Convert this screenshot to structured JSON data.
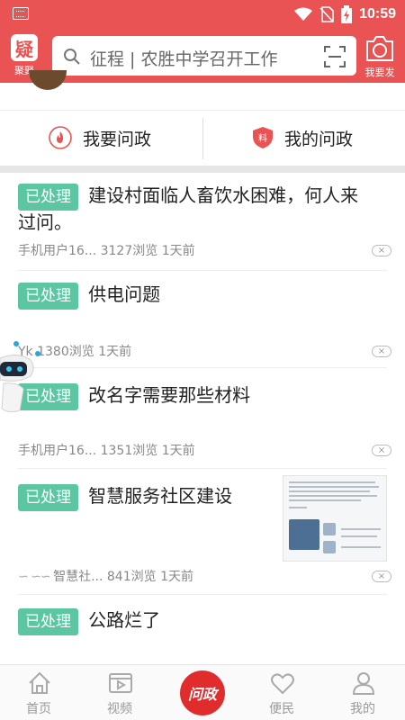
{
  "status_bar": {
    "time": "10:59"
  },
  "header": {
    "logo_char": "疑",
    "logo_label": "聚聚",
    "search_text": "征程 | 农胜中学召开工作",
    "camera_label": "我要发"
  },
  "actions": {
    "left_label": "我要问政",
    "right_label": "我的问政",
    "right_icon_char": "料"
  },
  "list": [
    {
      "badge": "已处理",
      "title_line1": "建设村面临人畜饮水困难，何人来",
      "title_line2": "过问。",
      "meta": "手机用户16... 3127浏览 1天前",
      "close": "×"
    },
    {
      "badge": "已处理",
      "title": "供电问题",
      "meta": "Yk 1380浏览 1天前",
      "close": "×"
    },
    {
      "badge": "已处理",
      "title": "改名字需要那些材料",
      "meta": "手机用户16... 1351浏览 1天前",
      "close": "×"
    },
    {
      "badge": "已处理",
      "title": "智慧服务社区建设",
      "meta": "智慧社... 841浏览 1天前",
      "close": "×"
    },
    {
      "badge": "已处理",
      "title": "公路烂了"
    }
  ],
  "bottom_nav": {
    "home": "首页",
    "video": "视频",
    "center": "问政",
    "service": "便民",
    "mine": "我的"
  },
  "colors": {
    "brand_red": "#e95353",
    "badge_green": "#5cc6a3",
    "center_red": "#e02c2c"
  }
}
